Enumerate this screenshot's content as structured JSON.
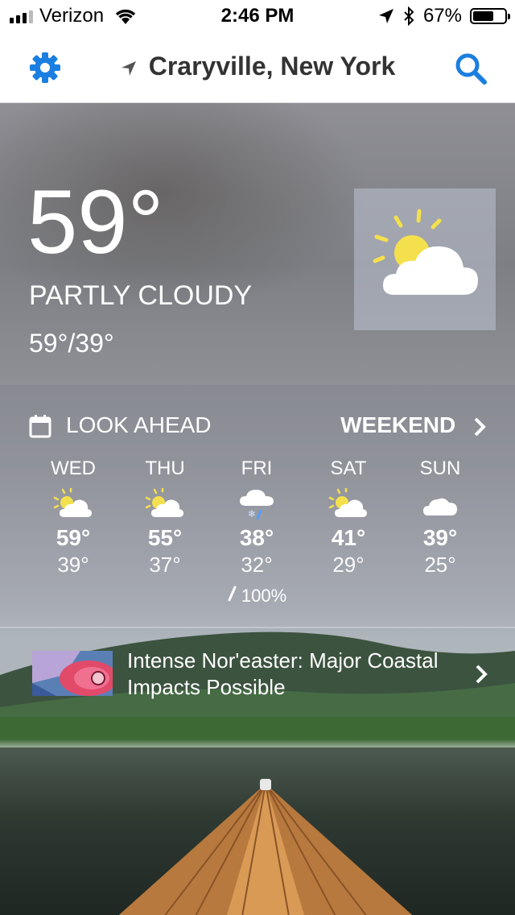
{
  "status_bar": {
    "carrier": "Verizon",
    "time": "2:46 PM",
    "battery_text": "67%",
    "battery_level": 0.67
  },
  "nav": {
    "location": "Craryville, New York",
    "icons": [
      "gear-icon",
      "location-arrow-icon",
      "search-icon"
    ],
    "accent_color": "#1a7fe0"
  },
  "current": {
    "temperature": "59°",
    "condition": "PARTLY CLOUDY",
    "hi_lo": "59°/39°",
    "icon": "partly-cloudy-icon"
  },
  "look_ahead": {
    "title": "LOOK AHEAD",
    "weekend_label": "WEEKEND",
    "days": [
      {
        "name": "WED",
        "hi": "59°",
        "lo": "39°",
        "icon": "partly-cloudy-icon",
        "precip": ""
      },
      {
        "name": "THU",
        "hi": "55°",
        "lo": "37°",
        "icon": "partly-cloudy-icon",
        "precip": ""
      },
      {
        "name": "FRI",
        "hi": "38°",
        "lo": "32°",
        "icon": "rain-snow-icon",
        "precip": "100%"
      },
      {
        "name": "SAT",
        "hi": "41°",
        "lo": "29°",
        "icon": "partly-cloudy-icon",
        "precip": ""
      },
      {
        "name": "SUN",
        "hi": "39°",
        "lo": "25°",
        "icon": "cloudy-icon",
        "precip": ""
      }
    ]
  },
  "news": {
    "headline": "Intense Nor'easter: Major Coastal Impacts Possible"
  }
}
